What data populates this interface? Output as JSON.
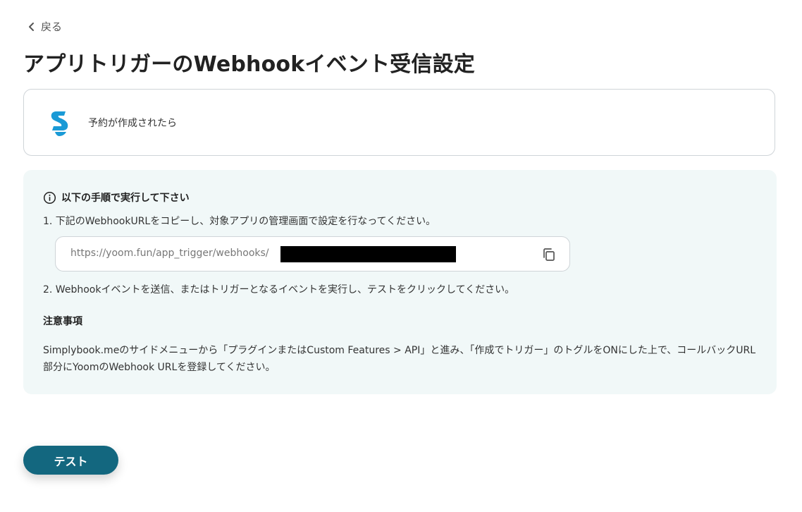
{
  "nav": {
    "back_label": "戻る",
    "back_icon": "chevron-left-icon"
  },
  "page": {
    "title": "アプリトリガーのWebhookイベント受信設定"
  },
  "trigger": {
    "app_icon": "simplybook-logo-icon",
    "event_label": "予約が作成されたら",
    "brand_color": "#1a9ad6"
  },
  "instructions": {
    "heading": "以下の手順で実行して下さい",
    "heading_icon": "info-icon",
    "step1": "1. 下記のWebhookURLをコピーし、対象アプリの管理画面で設定を行なってください。",
    "webhook_url": "https://yoom.fun/app_trigger/webhooks/",
    "copy_icon": "copy-icon",
    "step2": "2. Webhookイベントを送信、またはトリガーとなるイベントを実行し、テストをクリックしてください。",
    "notes_heading": "注意事項",
    "notes_body": "Simplybook.meのサイドメニューから「プラグインまたはCustom Features > API」と進み、「作成でトリガー」のトグルをONにした上で、コールバックURL部分にYoomのWebhook URLを登録してください。",
    "panel_color": "#f1f8f8"
  },
  "actions": {
    "test_label": "テスト",
    "test_color": "#13677f"
  }
}
